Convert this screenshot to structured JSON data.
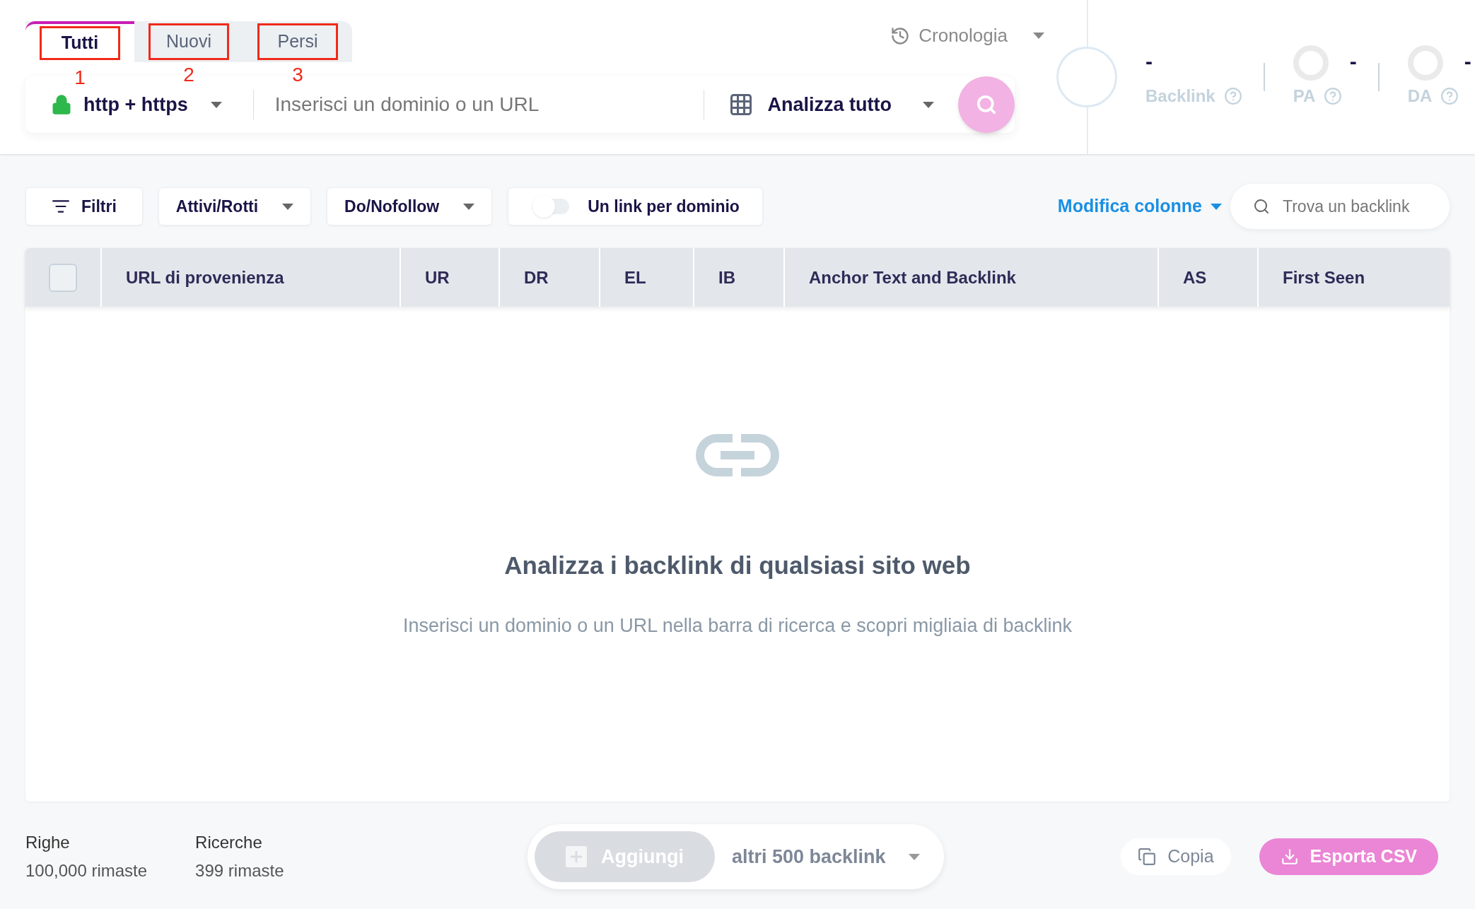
{
  "tabs": [
    {
      "label": "Tutti",
      "selected": true
    },
    {
      "label": "Nuovi",
      "selected": false
    },
    {
      "label": "Persi",
      "selected": false
    }
  ],
  "annotations": [
    {
      "label": "1"
    },
    {
      "label": "2"
    },
    {
      "label": "3"
    }
  ],
  "history": {
    "label": "Cronologia"
  },
  "search_bar": {
    "protocol": "http + https",
    "placeholder": "Inserisci un dominio o un URL",
    "scope": "Analizza tutto"
  },
  "stats": [
    {
      "kind": "main",
      "value": "-",
      "label": "Backlink"
    },
    {
      "kind": "ring",
      "value": "-",
      "label": "PA"
    },
    {
      "kind": "ring",
      "value": "-",
      "label": "DA"
    }
  ],
  "filters": [
    {
      "kind": "icon",
      "label": "Filtri"
    },
    {
      "kind": "dropdown",
      "label": "Attivi/Rotti"
    },
    {
      "kind": "dropdown",
      "label": "Do/Nofollow"
    },
    {
      "kind": "toggle",
      "label": "Un link per dominio",
      "on": false
    }
  ],
  "edit_columns": "Modifica colonne",
  "backlink_search": {
    "placeholder": "Trova un backlink"
  },
  "table": {
    "select_all_checked": false,
    "columns": [
      "URL di provenienza",
      "UR",
      "DR",
      "EL",
      "IB",
      "Anchor Text and Backlink",
      "AS",
      "First Seen"
    ]
  },
  "empty_state": {
    "title": "Analizza i backlink di qualsiasi sito web",
    "subtitle": "Inserisci un dominio o un URL nella barra di ricerca e scopri migliaia di backlink"
  },
  "footer": {
    "counters": [
      {
        "label": "Righe",
        "value": "100,000 rimaste"
      },
      {
        "label": "Ricerche",
        "value": "399 rimaste"
      }
    ],
    "add_button": "Aggiungi",
    "add_amount": "altri 500 backlink",
    "copy": "Copia",
    "export": "Esporta CSV"
  }
}
